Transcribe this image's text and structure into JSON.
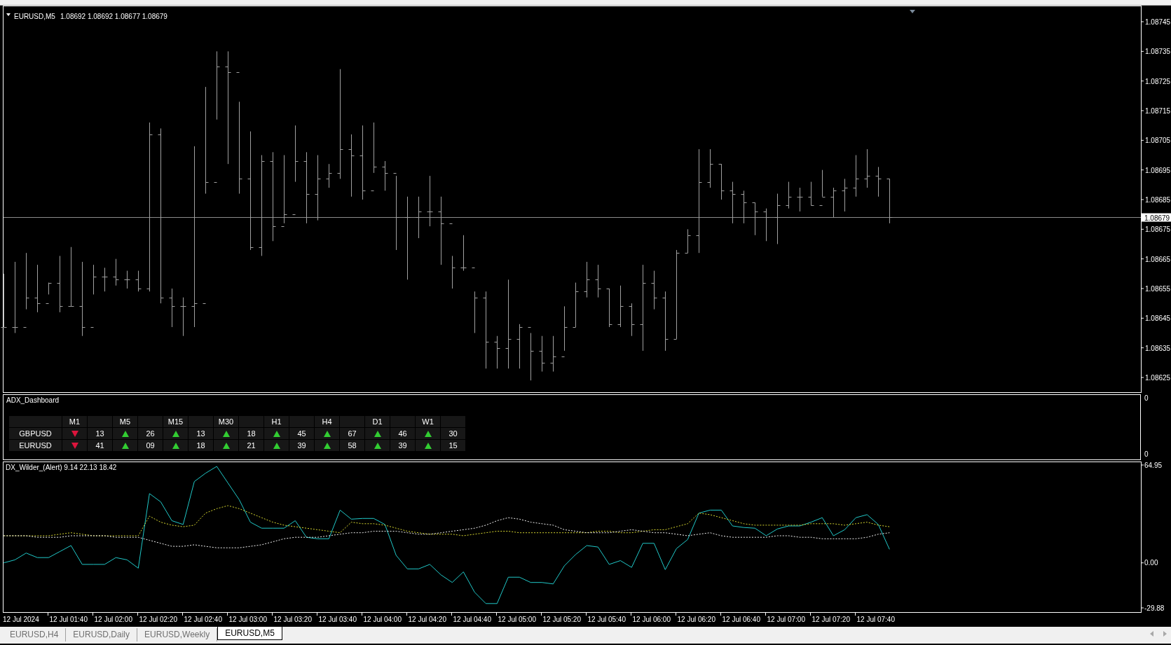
{
  "price_chart": {
    "symbol": "EURUSD,M5",
    "ohlc": "1.08692 1.08692 1.08677 1.08679",
    "last_price": "1.08679",
    "price_axis": [
      "1.08745",
      "1.08735",
      "1.08725",
      "1.08715",
      "1.08705",
      "1.08695",
      "1.08685",
      "1.08675",
      "1.08665",
      "1.08655",
      "1.08645",
      "1.08635",
      "1.08625"
    ]
  },
  "dashboard": {
    "title": "ADX_Dashboard",
    "axis_labels": [
      "0",
      "0"
    ],
    "timeframes": [
      "M1",
      "M5",
      "M15",
      "M30",
      "H1",
      "H4",
      "D1",
      "W1"
    ],
    "rows": [
      {
        "symbol": "GBPUSD",
        "cells": [
          {
            "rising": false,
            "value": "13"
          },
          {
            "rising": true,
            "value": "26"
          },
          {
            "rising": true,
            "value": "13"
          },
          {
            "rising": true,
            "value": "18"
          },
          {
            "rising": true,
            "value": "45"
          },
          {
            "rising": true,
            "value": "67"
          },
          {
            "rising": true,
            "value": "46"
          },
          {
            "rising": true,
            "value": "30"
          }
        ]
      },
      {
        "symbol": "EURUSD",
        "cells": [
          {
            "rising": false,
            "value": "41"
          },
          {
            "rising": true,
            "value": "09"
          },
          {
            "rising": true,
            "value": "18"
          },
          {
            "rising": true,
            "value": "21"
          },
          {
            "rising": true,
            "value": "39"
          },
          {
            "rising": true,
            "value": "58"
          },
          {
            "rising": true,
            "value": "39"
          },
          {
            "rising": true,
            "value": "15"
          }
        ]
      }
    ]
  },
  "indicator": {
    "title": "DX_Wilder_(Alert) 9.14 22.13 18.42",
    "axis_labels": [
      "64.95",
      "0.00",
      "-29.88"
    ]
  },
  "time_axis": [
    "12 Jul 2024",
    "12 Jul 01:40",
    "12 Jul 02:00",
    "12 Jul 02:20",
    "12 Jul 02:40",
    "12 Jul 03:00",
    "12 Jul 03:20",
    "12 Jul 03:40",
    "12 Jul 04:00",
    "12 Jul 04:20",
    "12 Jul 04:40",
    "12 Jul 05:00",
    "12 Jul 05:20",
    "12 Jul 05:40",
    "12 Jul 06:00",
    "12 Jul 06:20",
    "12 Jul 06:40",
    "12 Jul 07:00",
    "12 Jul 07:20",
    "12 Jul 07:40"
  ],
  "tabs": [
    {
      "label": "EURUSD,H4",
      "selected": false
    },
    {
      "label": "EURUSD,Daily",
      "selected": false
    },
    {
      "label": "EURUSD,Weekly",
      "selected": false
    },
    {
      "label": "EURUSD,M5",
      "selected": true
    }
  ]
}
